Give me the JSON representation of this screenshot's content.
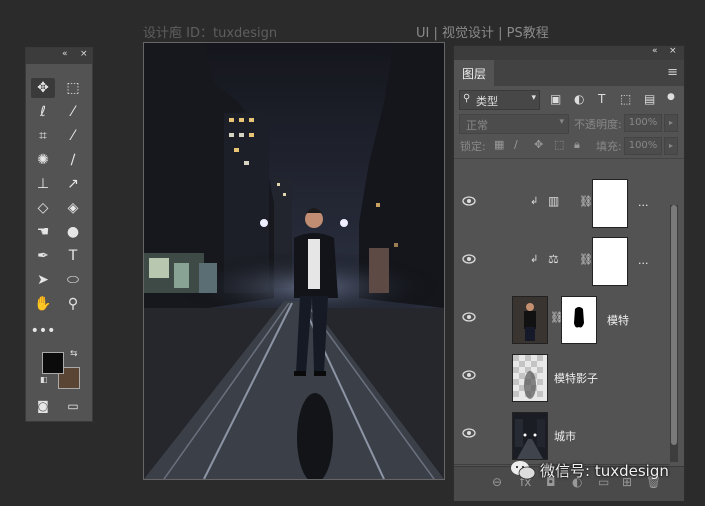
{
  "watermark": {
    "left": "设计庖 ID：tuxdesign",
    "right": "UI | 视觉设计 | PS教程"
  },
  "toolbox": {
    "collapse_glyphs": "«  ×",
    "tools": [
      "move-icon",
      "marquee-icon",
      "lasso-icon",
      "magic-wand-icon",
      "crop-icon",
      "eyedropper-icon",
      "spot-heal-icon",
      "brush-icon",
      "stamp-icon",
      "history-brush-icon",
      "eraser-icon",
      "bucket-icon",
      "smudge-icon",
      "dodge-icon",
      "pen-icon",
      "type-icon",
      "path-select-icon",
      "shape-icon",
      "hand-icon",
      "zoom-icon",
      "more-icon"
    ],
    "type_glyph": "T",
    "more_glyph": "•••",
    "colors": {
      "foreground": "#0b0b0b",
      "background": "#5a4434"
    }
  },
  "canvas": {
    "description_hidden": true
  },
  "layers_panel": {
    "collapse_glyphs": "«  ×",
    "tab": "图层",
    "menu_glyph": "≡",
    "filter": {
      "kind": "类型"
    },
    "blend": {
      "mode": "正常",
      "opacity_label": "不透明度:",
      "opacity_value": "100%"
    },
    "lock": {
      "label": "锁定:",
      "fill_label": "填充:",
      "fill_value": "100%"
    },
    "layers": [
      {
        "name": "",
        "type": "adjustment",
        "dots": "..."
      },
      {
        "name": "",
        "type": "adjustment",
        "dots": "..."
      },
      {
        "name": "模特",
        "type": "masked"
      },
      {
        "name": "模特影子",
        "type": "pixel"
      },
      {
        "name": "城市",
        "type": "pixel"
      }
    ]
  },
  "watermark_bottom": {
    "text": "微信号: tuxdesign"
  },
  "accent": "#ffffff"
}
